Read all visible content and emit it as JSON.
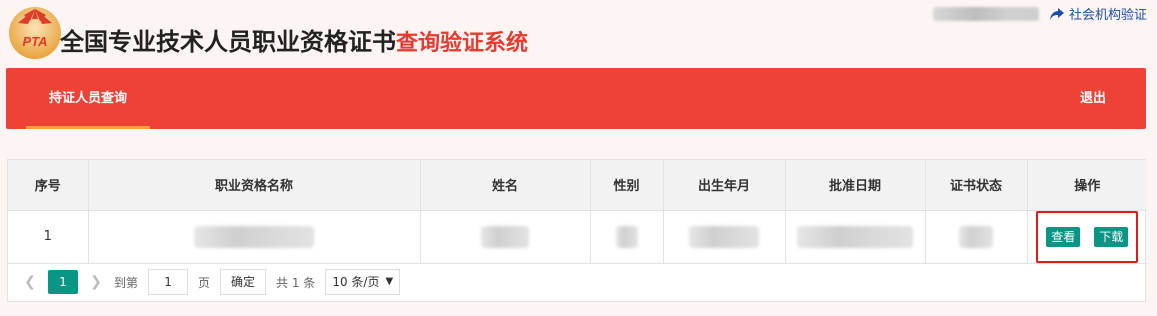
{
  "header": {
    "logo_text": "PTA",
    "title_main": "全国专业技术人员职业资格证书",
    "title_sub": "查询验证系统",
    "org_link": "社会机构验证"
  },
  "nav": {
    "tab_label": "持证人员查询",
    "logout_label": "退出"
  },
  "table": {
    "headers": [
      "序号",
      "职业资格名称",
      "姓名",
      "性别",
      "出生年月",
      "批准日期",
      "证书状态",
      "操作"
    ],
    "rows": [
      {
        "index": "1",
        "view_label": "查看",
        "download_label": "下载"
      }
    ]
  },
  "pager": {
    "current_page": "1",
    "goto_prefix": "到第",
    "goto_value": "1",
    "goto_suffix": "页",
    "confirm_label": "确定",
    "total_label": "共 1 条",
    "page_size_label": "10 条/页"
  },
  "colors": {
    "nav_bg": "#ef4237",
    "nav_active_underline": "#f7a23b",
    "title_accent": "#e63b2e",
    "button_green": "#0a9685",
    "highlight_border": "#e61919"
  }
}
